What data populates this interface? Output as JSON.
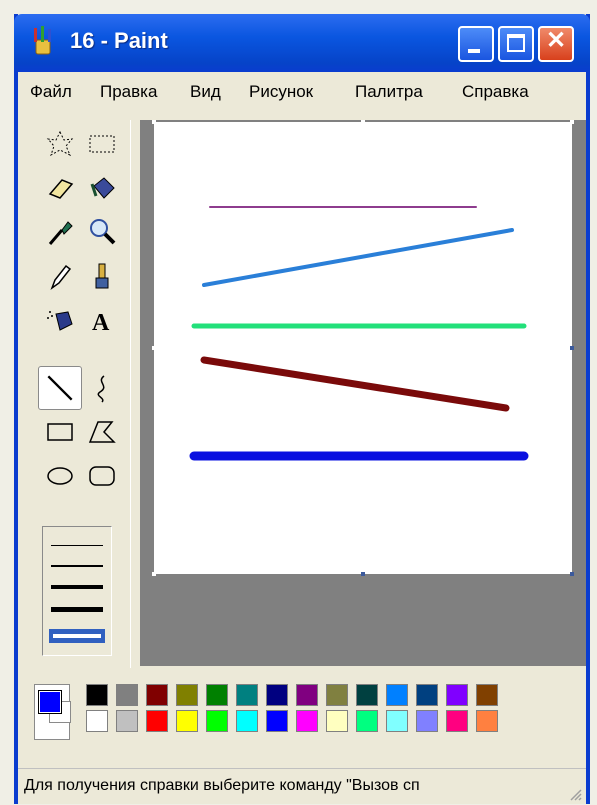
{
  "window": {
    "title": "16 - Paint"
  },
  "menu": [
    "Файл",
    "Правка",
    "Вид",
    "Рисунок",
    "Палитра",
    "Справка"
  ],
  "tools": [
    {
      "name": "free-form-select-tool"
    },
    {
      "name": "select-tool"
    },
    {
      "name": "eraser-tool"
    },
    {
      "name": "fill-tool"
    },
    {
      "name": "pick-color-tool"
    },
    {
      "name": "magnifier-tool"
    },
    {
      "name": "pencil-tool"
    },
    {
      "name": "brush-tool"
    },
    {
      "name": "airbrush-tool"
    },
    {
      "name": "text-tool"
    },
    {
      "name": "line-tool",
      "active": true
    },
    {
      "name": "curve-tool"
    },
    {
      "name": "rectangle-tool"
    },
    {
      "name": "polygon-tool"
    },
    {
      "name": "ellipse-tool"
    },
    {
      "name": "rounded-rectangle-tool"
    }
  ],
  "text_tool_glyph": "A",
  "canvas_lines": [
    {
      "color": "#8e3c8e",
      "name": "purple-line"
    },
    {
      "color": "#2a7fd8",
      "name": "blue-diagonal-line"
    },
    {
      "color": "#22e07a",
      "name": "green-line"
    },
    {
      "color": "#7a0a0a",
      "name": "dark-red-line"
    },
    {
      "color": "#0a10e0",
      "name": "blue-line"
    }
  ],
  "colors": {
    "foreground": "#0000ff",
    "background": "#ffffff",
    "palette_top": [
      "#000000",
      "#808080",
      "#800000",
      "#808000",
      "#008000",
      "#008080",
      "#000080",
      "#800080",
      "#808040",
      "#004040",
      "#0080ff",
      "#004080",
      "#8000ff",
      "#804000"
    ],
    "palette_bottom": [
      "#ffffff",
      "#c0c0c0",
      "#ff0000",
      "#ffff00",
      "#00ff00",
      "#00ffff",
      "#0000ff",
      "#ff00ff",
      "#ffffc0",
      "#00ff80",
      "#80ffff",
      "#8080ff",
      "#ff0080",
      "#ff8040"
    ]
  },
  "status": "Для получения справки выберите команду \"Вызов сп"
}
